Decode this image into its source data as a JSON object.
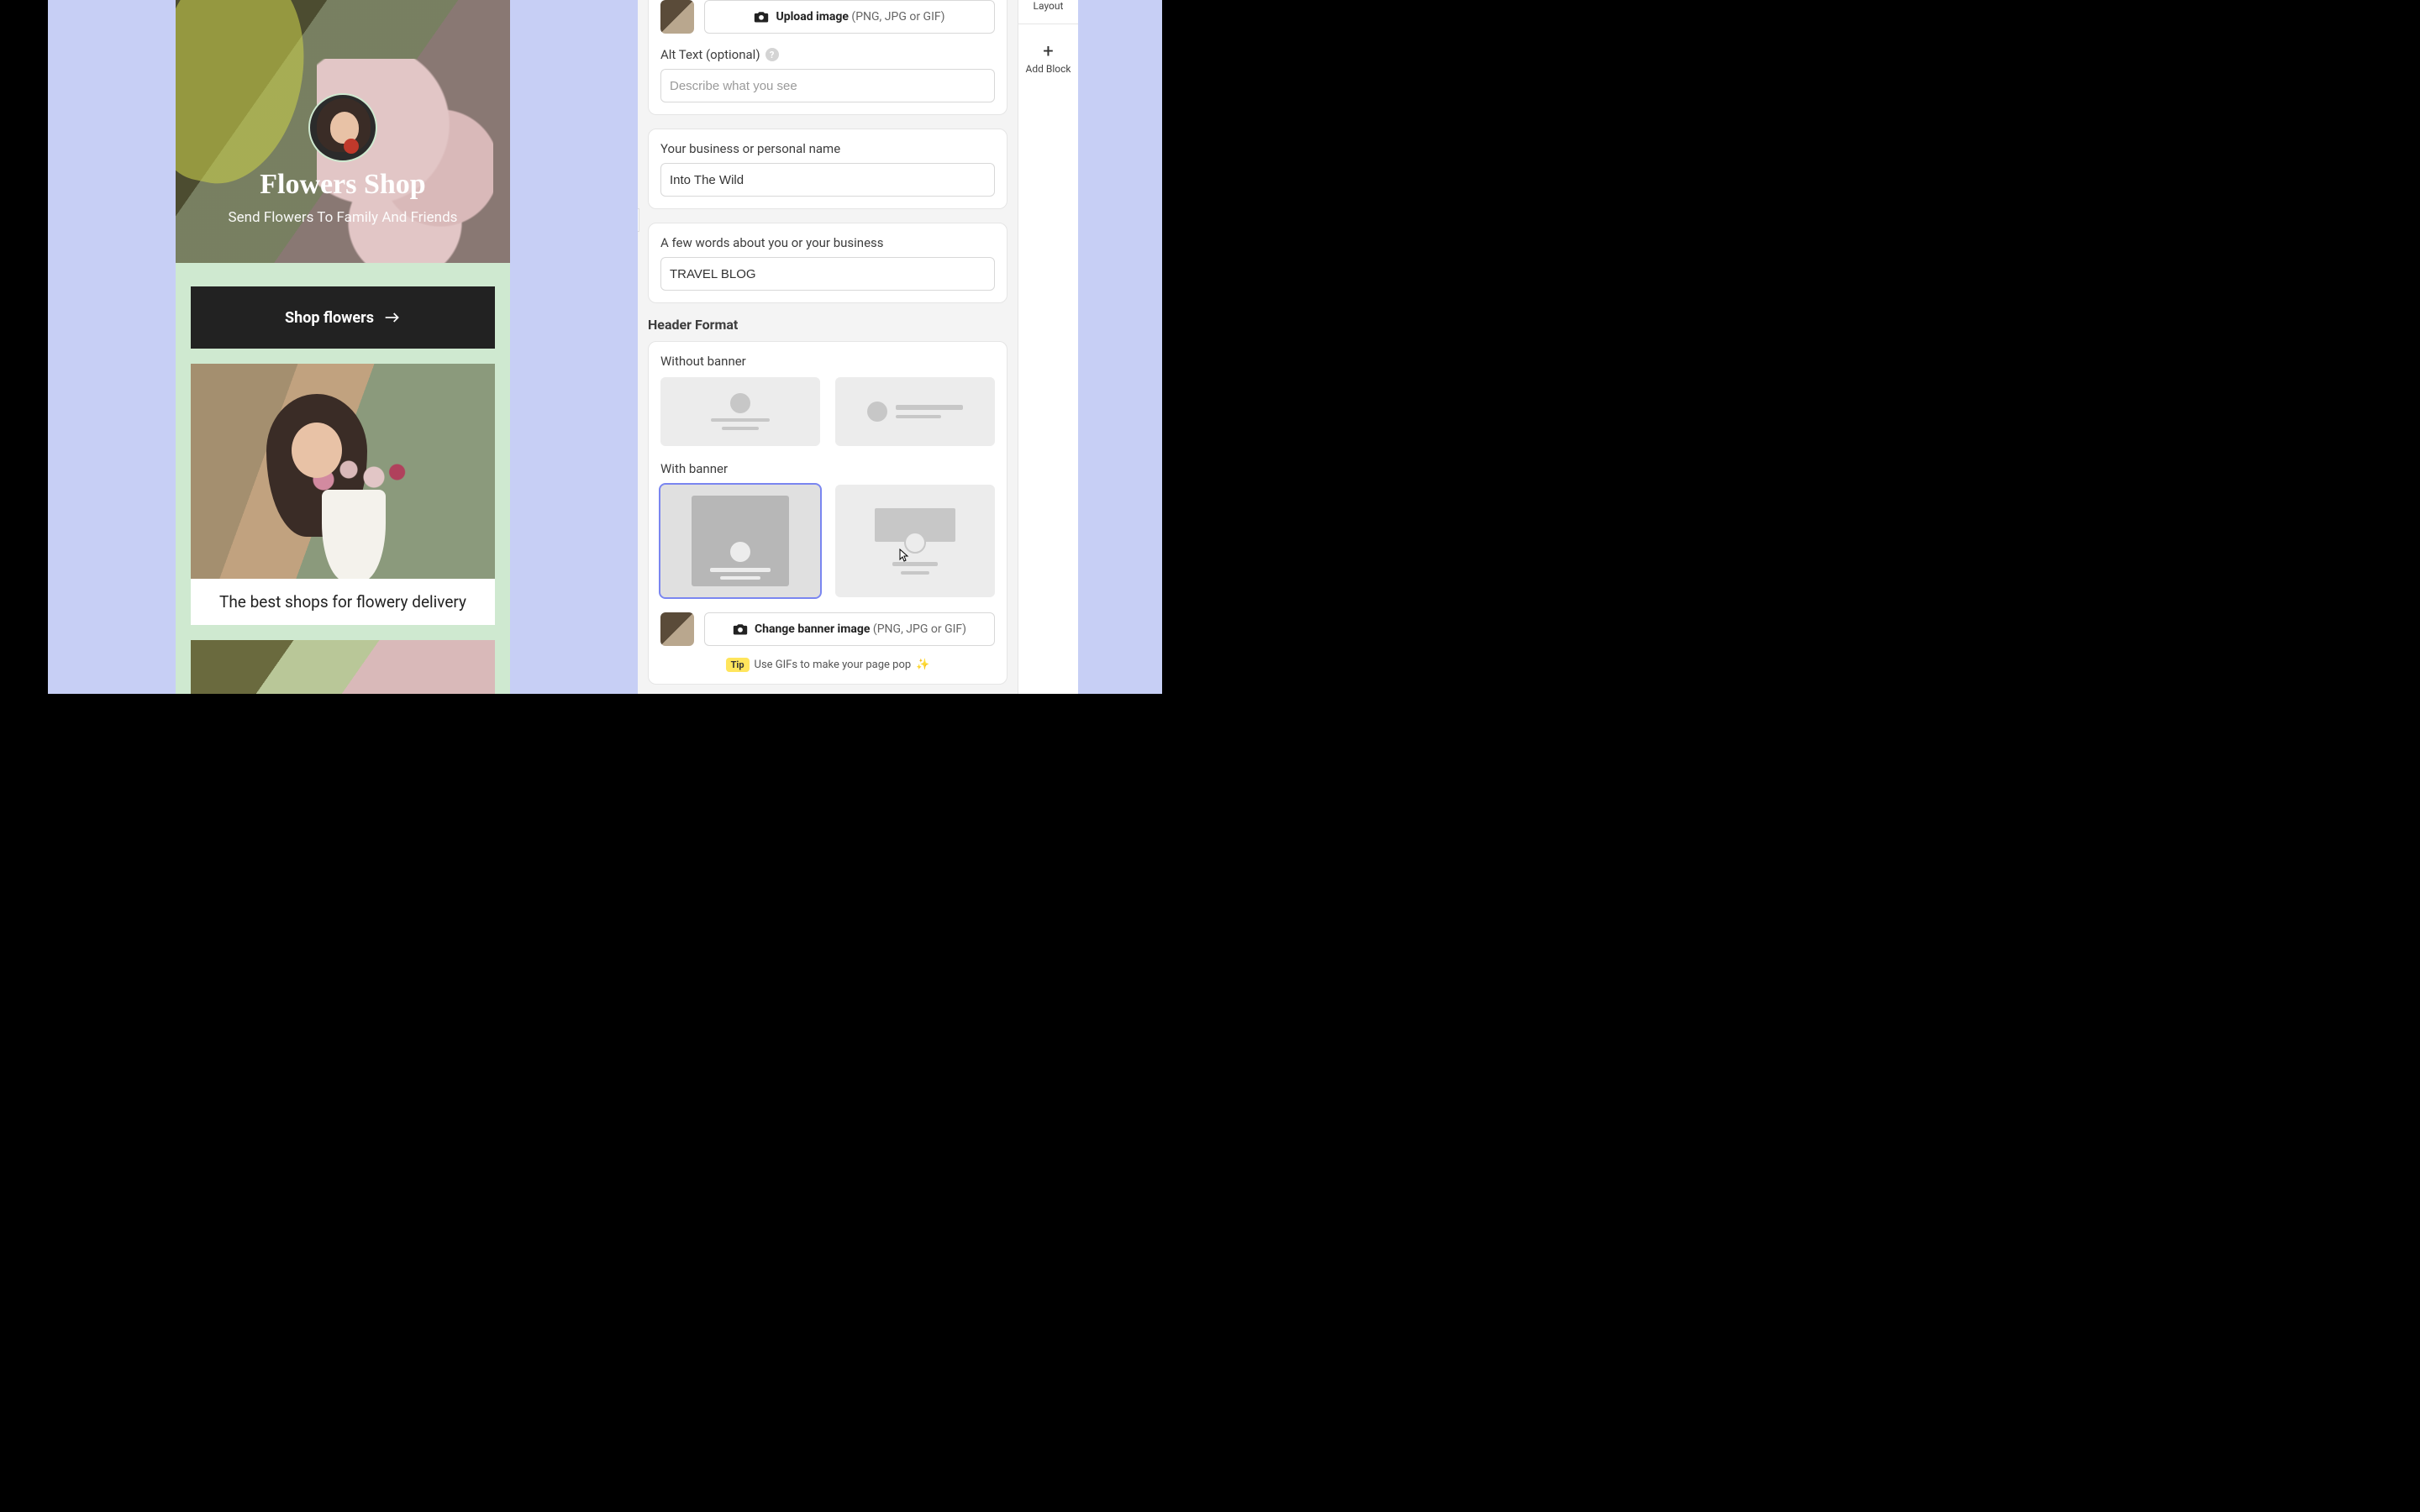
{
  "preview": {
    "hero_title": "Flowers Shop",
    "hero_subtitle": "Send Flowers To Family And Friends",
    "shop_button": "Shop flowers",
    "card1_caption": "The best shops for flowery delivery"
  },
  "settings": {
    "upload_image_bold": "Upload image",
    "upload_image_hint": " (PNG, JPG or GIF)",
    "alt_text_label": "Alt Text (optional)",
    "alt_text_placeholder": "Describe what you see",
    "business_name_label": "Your business or personal name",
    "business_name_value": "Into The Wild",
    "about_label": "A few words about you or your business",
    "about_value": "TRAVEL BLOG",
    "header_format_title": "Header Format",
    "without_banner_label": "Without banner",
    "with_banner_label": "With banner",
    "change_banner_bold": "Change banner image",
    "change_banner_hint": " (PNG, JPG or GIF)",
    "tip_badge": "Tip",
    "tip_text": "Use GIFs to make your page pop",
    "sparkle": "✨"
  },
  "rail": {
    "layout": "Layout",
    "add_block": "Add Block"
  }
}
